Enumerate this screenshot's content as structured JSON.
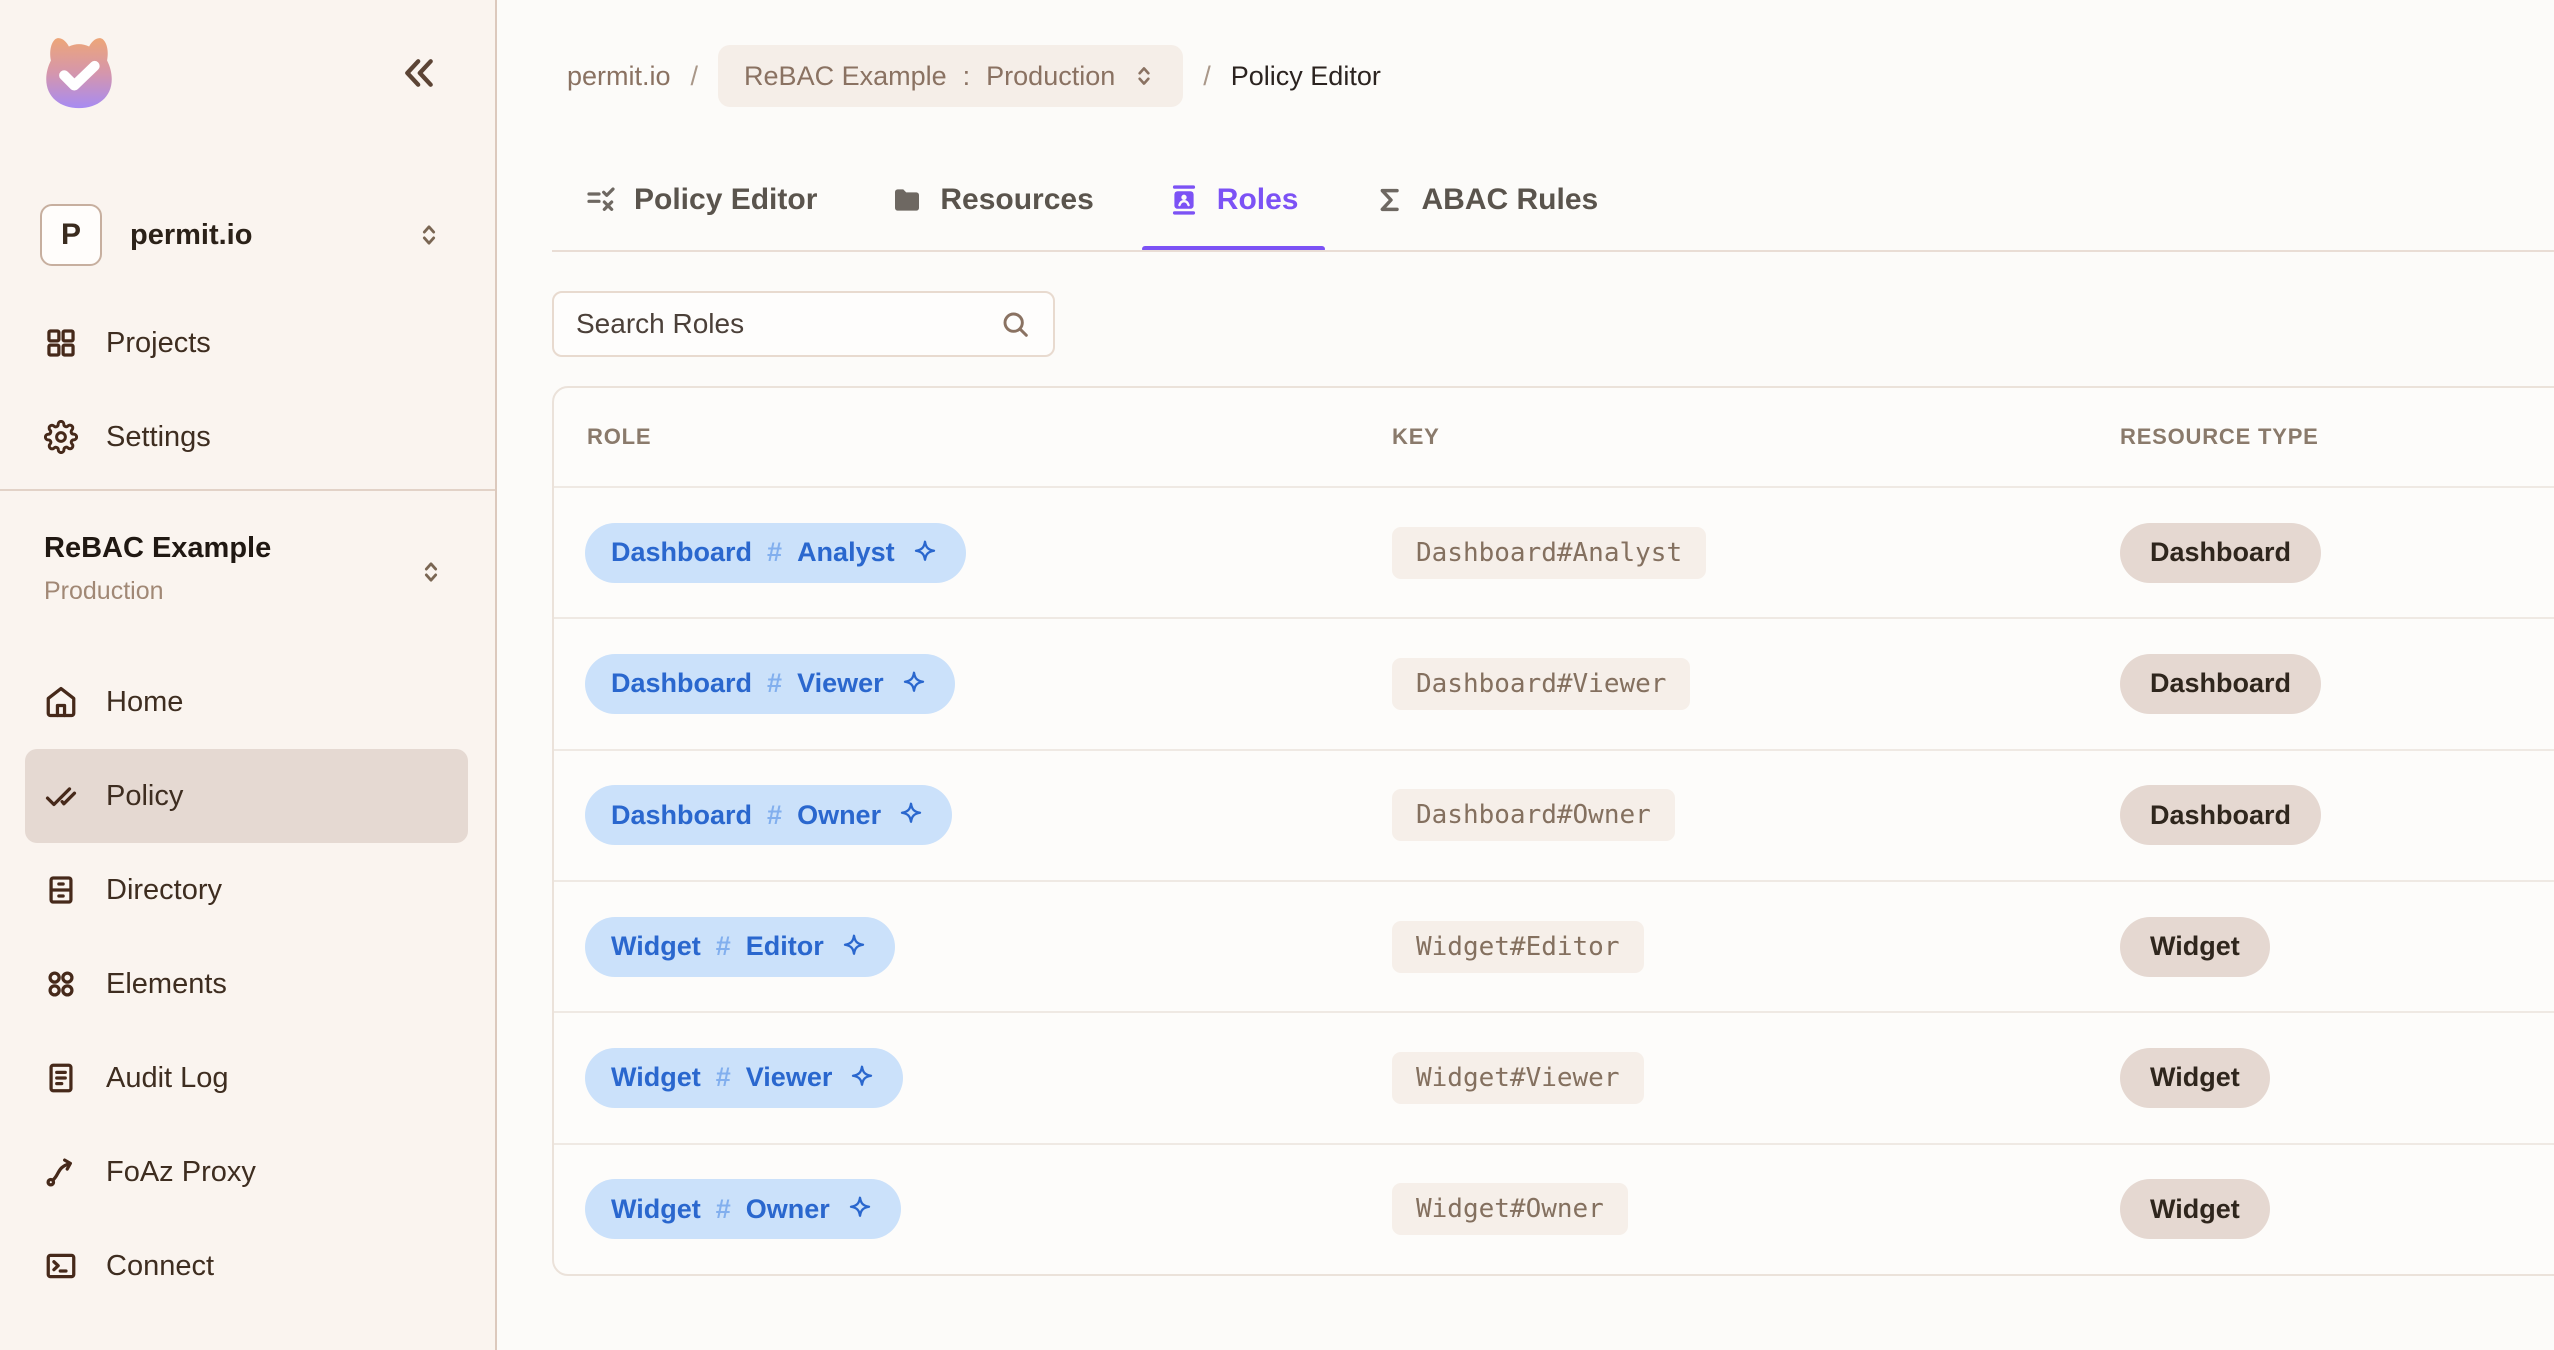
{
  "sidebar": {
    "workspace": {
      "initial": "P",
      "name": "permit.io"
    },
    "nav_top": [
      {
        "label": "Projects"
      },
      {
        "label": "Settings"
      }
    ],
    "project": {
      "name": "ReBAC Example",
      "environment": "Production"
    },
    "nav_main": [
      {
        "label": "Home"
      },
      {
        "label": "Policy",
        "active": true
      },
      {
        "label": "Directory"
      },
      {
        "label": "Elements"
      },
      {
        "label": "Audit Log"
      },
      {
        "label": "FoAz Proxy"
      },
      {
        "label": "Connect"
      }
    ]
  },
  "breadcrumb": {
    "org": "permit.io",
    "sep": "/",
    "project": "ReBAC Example",
    "colon": ":",
    "environment": "Production",
    "page": "Policy Editor"
  },
  "tabs": [
    {
      "label": "Policy Editor"
    },
    {
      "label": "Resources"
    },
    {
      "label": "Roles",
      "active": true
    },
    {
      "label": "ABAC Rules"
    }
  ],
  "search": {
    "placeholder": "Search Roles"
  },
  "table": {
    "hash": "#",
    "columns": [
      "ROLE",
      "KEY",
      "RESOURCE TYPE"
    ],
    "rows": [
      {
        "role_resource": "Dashboard",
        "role_name": "Analyst",
        "key": "Dashboard#Analyst",
        "resource_type": "Dashboard"
      },
      {
        "role_resource": "Dashboard",
        "role_name": "Viewer",
        "key": "Dashboard#Viewer",
        "resource_type": "Dashboard"
      },
      {
        "role_resource": "Dashboard",
        "role_name": "Owner",
        "key": "Dashboard#Owner",
        "resource_type": "Dashboard"
      },
      {
        "role_resource": "Widget",
        "role_name": "Editor",
        "key": "Widget#Editor",
        "resource_type": "Widget"
      },
      {
        "role_resource": "Widget",
        "role_name": "Viewer",
        "key": "Widget#Viewer",
        "resource_type": "Widget"
      },
      {
        "role_resource": "Widget",
        "role_name": "Owner",
        "key": "Widget#Owner",
        "resource_type": "Widget"
      }
    ]
  },
  "colors": {
    "accent_purple": "#7C52F5",
    "role_badge_blue": "#2A67CE",
    "role_badge_bg": "#CBE1FA",
    "sidebar_bg": "#FAF4EF",
    "resource_pill_bg": "#E5D8D1"
  }
}
